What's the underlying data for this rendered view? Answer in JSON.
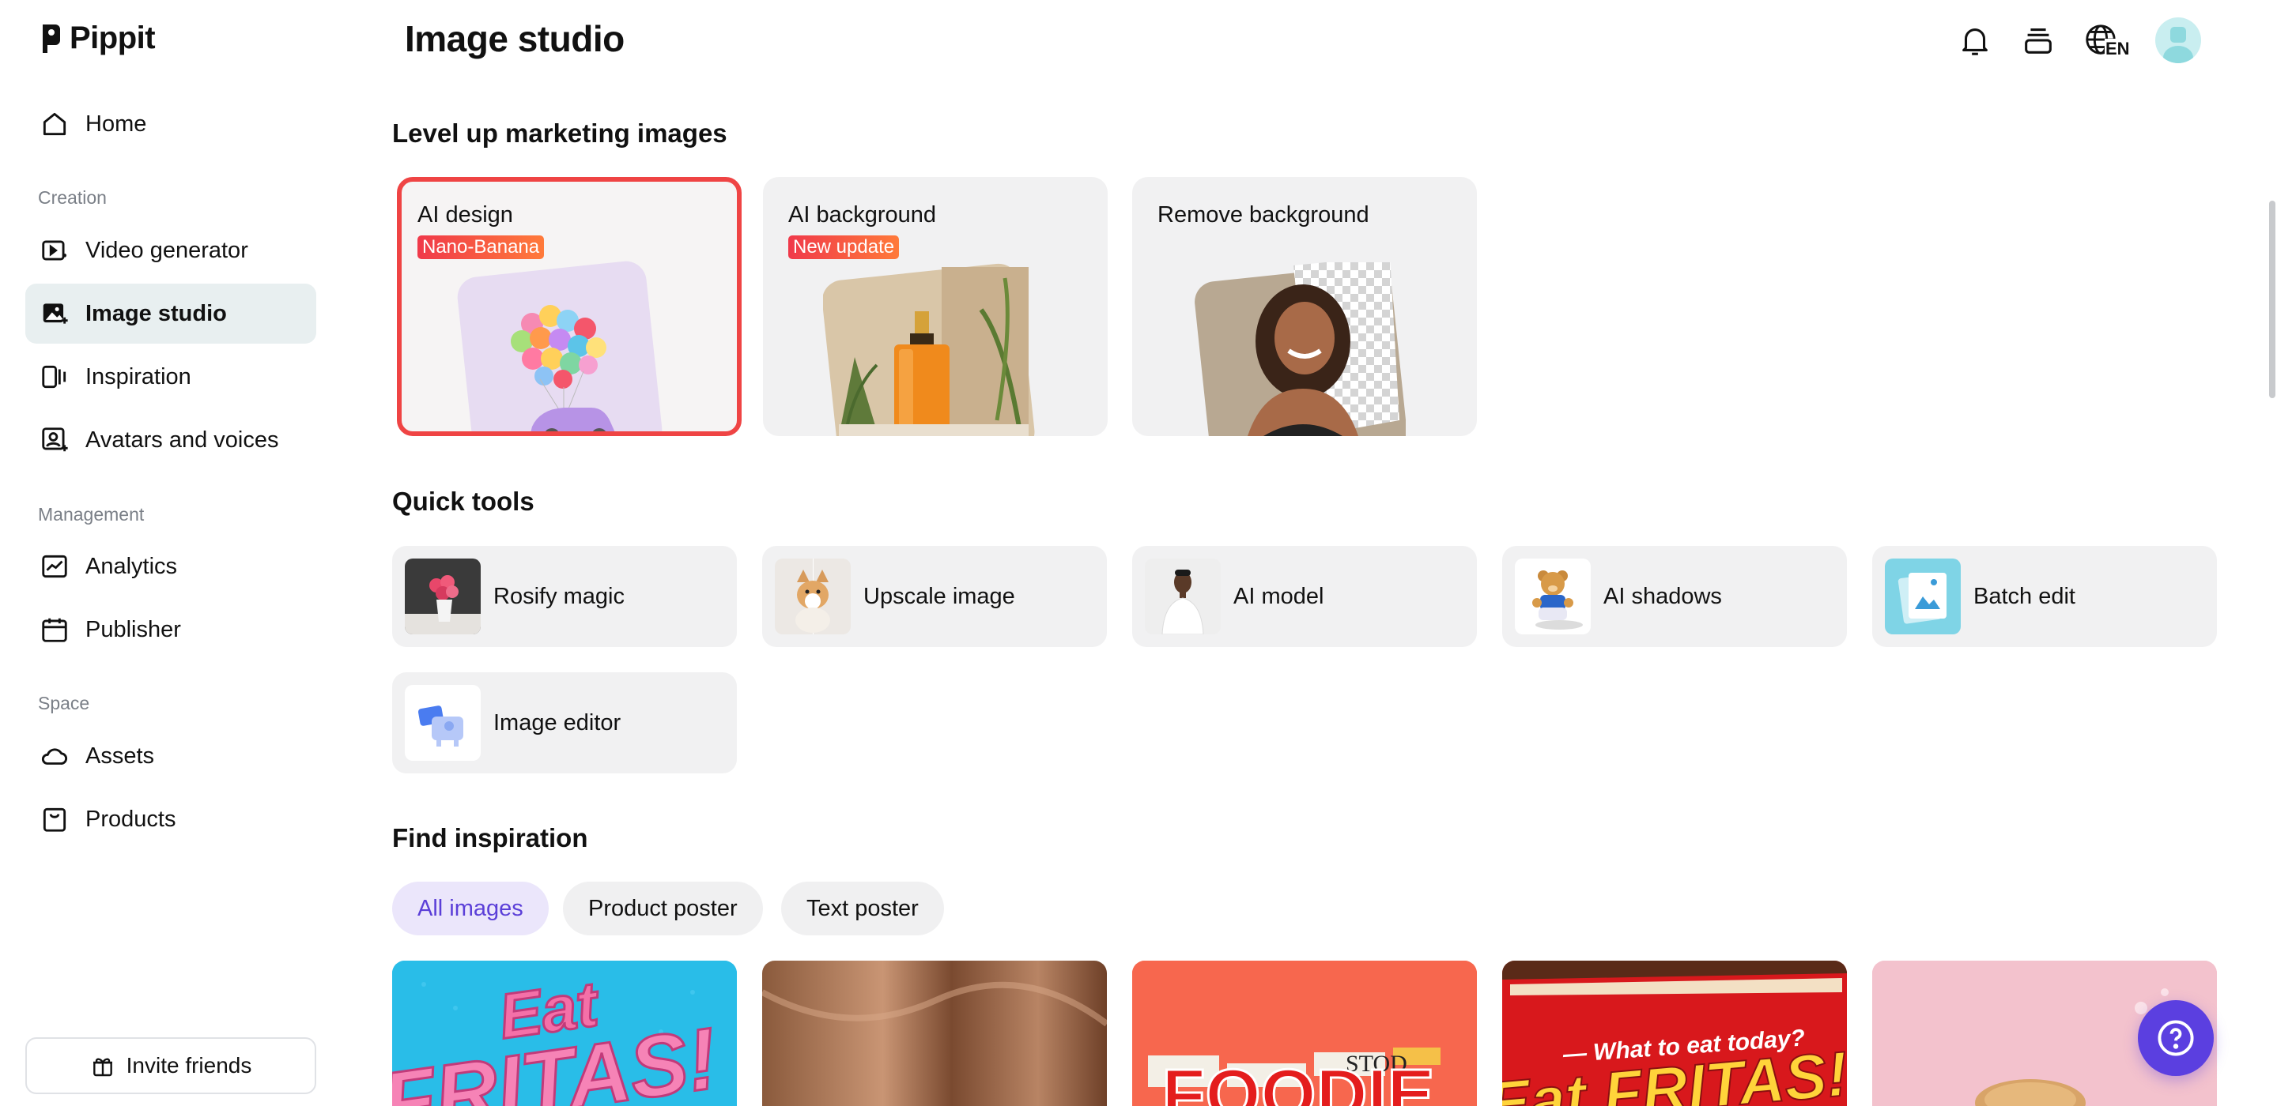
{
  "brand": {
    "name": "Pippit"
  },
  "sidebar": {
    "home": "Home",
    "section_creation": "Creation",
    "video_generator": "Video generator",
    "image_studio": "Image studio",
    "inspiration": "Inspiration",
    "avatars_voices": "Avatars and voices",
    "section_management": "Management",
    "analytics": "Analytics",
    "publisher": "Publisher",
    "section_space": "Space",
    "assets": "Assets",
    "products": "Products",
    "invite": "Invite friends"
  },
  "header": {
    "title": "Image studio",
    "language": "EN"
  },
  "marketing": {
    "heading": "Level up marketing images",
    "cards": [
      {
        "title": "AI design",
        "badge": "Nano-Banana"
      },
      {
        "title": "AI background",
        "badge": "New update"
      },
      {
        "title": "Remove background"
      }
    ]
  },
  "quick_tools": {
    "heading": "Quick tools",
    "items": [
      {
        "label": "Rosify magic"
      },
      {
        "label": "Upscale image"
      },
      {
        "label": "AI model"
      },
      {
        "label": "AI shadows"
      },
      {
        "label": "Batch edit"
      },
      {
        "label": "Image editor"
      }
    ]
  },
  "inspiration": {
    "heading": "Find inspiration",
    "filters": [
      "All images",
      "Product poster",
      "Text poster"
    ],
    "active_filter": "All images",
    "cards": [
      {
        "text": "Eat FRITAS!"
      },
      {
        "text": ""
      },
      {
        "text": "FOODIE"
      },
      {
        "text": "What to eat today? Eat FRITAS!"
      },
      {
        "text": ""
      }
    ]
  },
  "colors": {
    "accent": "#5b3fe0",
    "selected_border": "#ef4444",
    "active_nav": "#e8eff0",
    "badge_start": "#f0394a",
    "badge_end": "#ff7a3a"
  }
}
